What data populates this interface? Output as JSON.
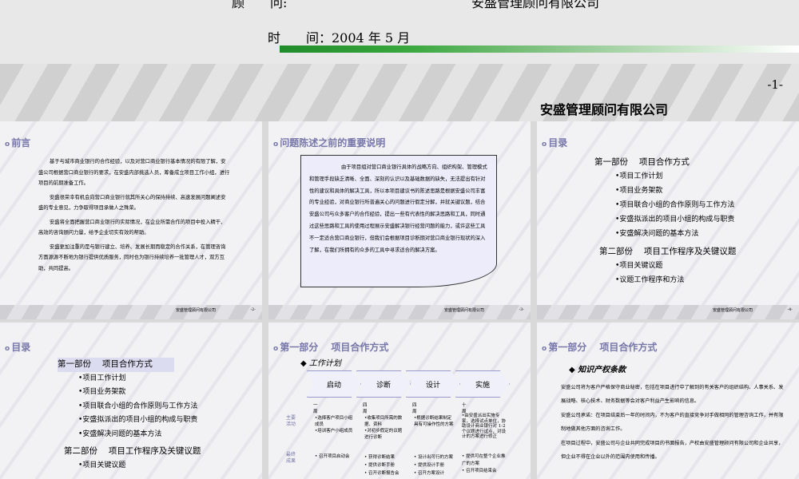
{
  "cover": {
    "advisor_label": "顾　　问:",
    "advisor_value": "安盛管理顾问有限公司",
    "time_label": "时　　间：2004 年 5 月"
  },
  "slide1": {
    "page_number": "-1-",
    "company": "安盛管理顾问有限公司"
  },
  "footer_company": "安盛管理顾问有限公司",
  "slide2": {
    "page": "-2-",
    "title": "前言",
    "paragraphs": [
      "基于与城市商业银行的合作经验，以及对营口商业银行基本情况的有限了解，安盛公司根据营口商业银行的要求，在安盛内部挑选人员，筹备成立项目工作小组，进行项目的前期准备工作。",
      "安盛很荣幸有机会向营口商业银行就其所关心的保持持续、高速发展问题阐述安盛的专业意见，力争取得项目承做人之殊荣。",
      "安盛将全面把握营口商业银行的实际情况，在企业所需合作的项目中投入精干、高效的咨询顾问力量，给予企业切实有效的帮助。",
      "安盛更加注重的是与银行建立、培养、发展长期而稳定的合作关系，在管理咨询方面源源不断地为银行提供优质服务，同时也为银行持续培养一批管理人才，双方互助，共同提高。"
    ]
  },
  "slide3": {
    "page": "-3-",
    "title": "问题陈述之前的重要说明",
    "text": "由于项目组对营口商业银行具体的战略方向、组织构架、管理模式和管理手段缺乏清晰、全面、深刻的认识以及基础数据的缺失，无法提出有针对性的建议和具体的解决工具，所以本项目建议书的陈述思路是根据安盛公司丰富的专业经验，对商业银行所普遍关心的问题进行假定分解，并就关键议题，结合安盛公司与众多客户的合作经验，提出一些有代表性的解决思路和工具，同时通过这些思路和工具的使用过程展示安盛解决银行经营问题的能力，或许这些工具不一定适合营口商业银行，但我们会根据项目诊断期对营口商业银行现状的深入了解，在我们所拥有的众多的工具中寻求适合的解决方案。"
  },
  "toc": {
    "title": "目录",
    "part1": "第一部份　 项目合作方式",
    "part1_items": [
      "项目工作计划",
      "项目业务架款",
      "项目联合小组的合作原则与工作方法",
      "安盛拟派出的项目小组的构成与职责",
      "安盛解决问题的基本方法"
    ],
    "part2": "第二部份　 项目工作程序及关键议题",
    "part2_items": [
      "项目关键议题",
      "议题工作程序和方法"
    ]
  },
  "slide4": {
    "page": "-4-"
  },
  "slide5": {
    "title": "目录",
    "part1": "第一部份　 项目合作方式",
    "part1_items": [
      "项目工作计划",
      "项目业务架款",
      "项目联合小组的合作原则与工作方法",
      "安盛拟派出的项目小组的构成与职责",
      "安盛解决问题的基本方法"
    ],
    "part2": "第二部份　 项目工作程序及关键议题",
    "part2_items": [
      "项目关键议题"
    ]
  },
  "slide6": {
    "title": "第一部分　 项目合作方式",
    "subtitle": "工作计划",
    "steps": [
      "启动",
      "诊断",
      "设计",
      "实施"
    ],
    "weeks": [
      "一\n周",
      "四\n周",
      "四\n周",
      "十\n周"
    ],
    "row1_label": "主要\n活动",
    "row2_label": "最终\n成果",
    "activities": [
      "•选择客户项目小组成员\n•培训客户小组成员",
      "•收集项目所需的数据、资料\n•对初步假定的议题进行诊断",
      "•根据诊断结果制定具有可操作性的方案",
      "•由安盛派出实施专家，选择试点单位，协助设计商业银行对 1-2 个议题进行试点，对设计的方案进行修正"
    ],
    "results": [
      "• 召开项目启动会",
      "• 获得诊断结果\n• 提供诊断手册\n• 召开诊断报告会",
      "• 设计出可行的方案\n• 提供设计手册\n• 召开方案设计",
      "• 提供可在整个企业推广的方案\n• 召开项目结束会"
    ]
  },
  "slide7": {
    "title": "第一部分　 项目合作方式",
    "subtitle": "知识产权条款",
    "paragraphs": [
      "安盛公司将为客户严格保守商业秘密，包括在项目进行中了解到的有关客户的组织结构、人事关系、发展战略、核心技术、财务数据等会对客户利益产生影响的信息。",
      "安盛公司承诺：在项目结束后一年的时间内，不为客户的直接竞争对手做相同的管理咨询工作，并有限制地做其他方面的咨询工作。",
      "在项目过程中，安盛公司与企业共同完成项目的书面报告，产权由安盛管理顾问有限公司和企业共享，但企业不得在企业以外的范围内使用和传播。"
    ]
  }
}
